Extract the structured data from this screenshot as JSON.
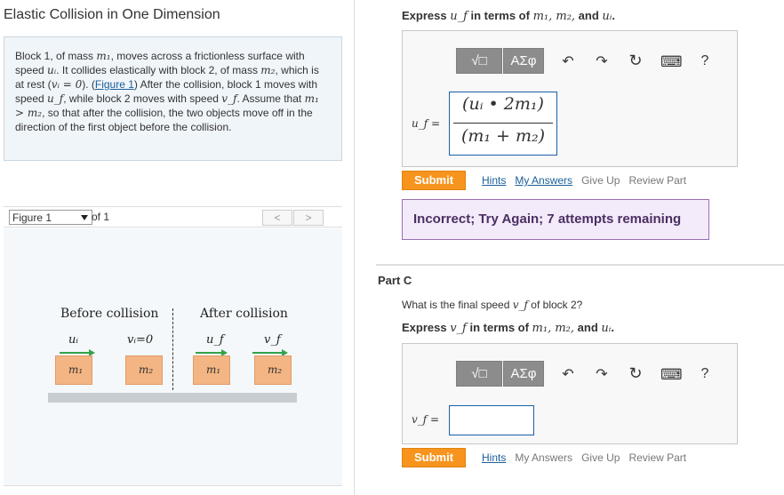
{
  "app_title": "Elastic Collision in One Dimension",
  "problem": {
    "t1": "Block 1, of mass ",
    "m1": "m₁",
    "t2": ", moves across a frictionless surface with speed ",
    "ui": "uᵢ",
    "t3": ". It collides elastically with block 2, of mass ",
    "m2": "m₂",
    "t4": ", which is at rest (",
    "vi_eq": "vᵢ = 0",
    "t5": "). (",
    "figure_link": "Figure 1",
    "t6": ") After the collision, block 1 moves with speed ",
    "uf": "u_f",
    "t7": ", while block 2 moves with speed ",
    "vf": "v_f",
    "t8": ". Assume that ",
    "ineq": "m₁ > m₂",
    "t9": ", so that after the collision, the two objects move off in the direction of the first object before the collision."
  },
  "figure_nav": {
    "select_value": "Figure 1",
    "of_label": "of 1",
    "prev": "<",
    "next": ">"
  },
  "figure": {
    "before_label": "Before collision",
    "after_label": "After collision",
    "ui_label": "uᵢ",
    "vi_label": "vᵢ=0",
    "uf_label": "u_f",
    "vf_label": "v_f",
    "m1": "m₁",
    "m2": "m₂"
  },
  "part_b": {
    "prompt_express": "Express ",
    "prompt_var": "u_f",
    "prompt_mid": " in terms of ",
    "prompt_vars": "m₁, m₂,",
    "prompt_and": " and ",
    "prompt_last": "uᵢ",
    "prompt_end": ".",
    "answer_label": "u_f =",
    "answer": {
      "num": "(uᵢ • 2m₁)",
      "den": "(m₁ + m₂)"
    },
    "submit": "Submit",
    "links": {
      "hints": "Hints",
      "my_answers": "My Answers",
      "give_up": "Give Up",
      "review": "Review Part"
    },
    "feedback": "Incorrect; Try Again; 7 attempts remaining"
  },
  "part_c": {
    "title": "Part C",
    "question_pre": "What is the final speed ",
    "question_var": "v_f",
    "question_post": " of block 2?",
    "prompt_express": "Express ",
    "prompt_var": "v_f",
    "prompt_mid": " in terms of ",
    "prompt_vars": "m₁, m₂,",
    "prompt_and": " and ",
    "prompt_last": "uᵢ",
    "prompt_end": ".",
    "answer_label": "v_f =",
    "answer_value": "",
    "submit": "Submit",
    "links": {
      "hints": "Hints",
      "my_answers": "My Answers",
      "give_up": "Give Up",
      "review": "Review Part"
    }
  },
  "toolbar": {
    "templates": "√□",
    "symbols": "ΑΣφ",
    "undo": "↶",
    "redo": "↷",
    "reset": "↻",
    "keyboard": "⌨",
    "help": "?"
  },
  "colors": {
    "submit": "#f7941d",
    "link": "#1a5e9a",
    "feedback_bg": "#f3eafa",
    "problem_bg": "#f0f5fa"
  }
}
